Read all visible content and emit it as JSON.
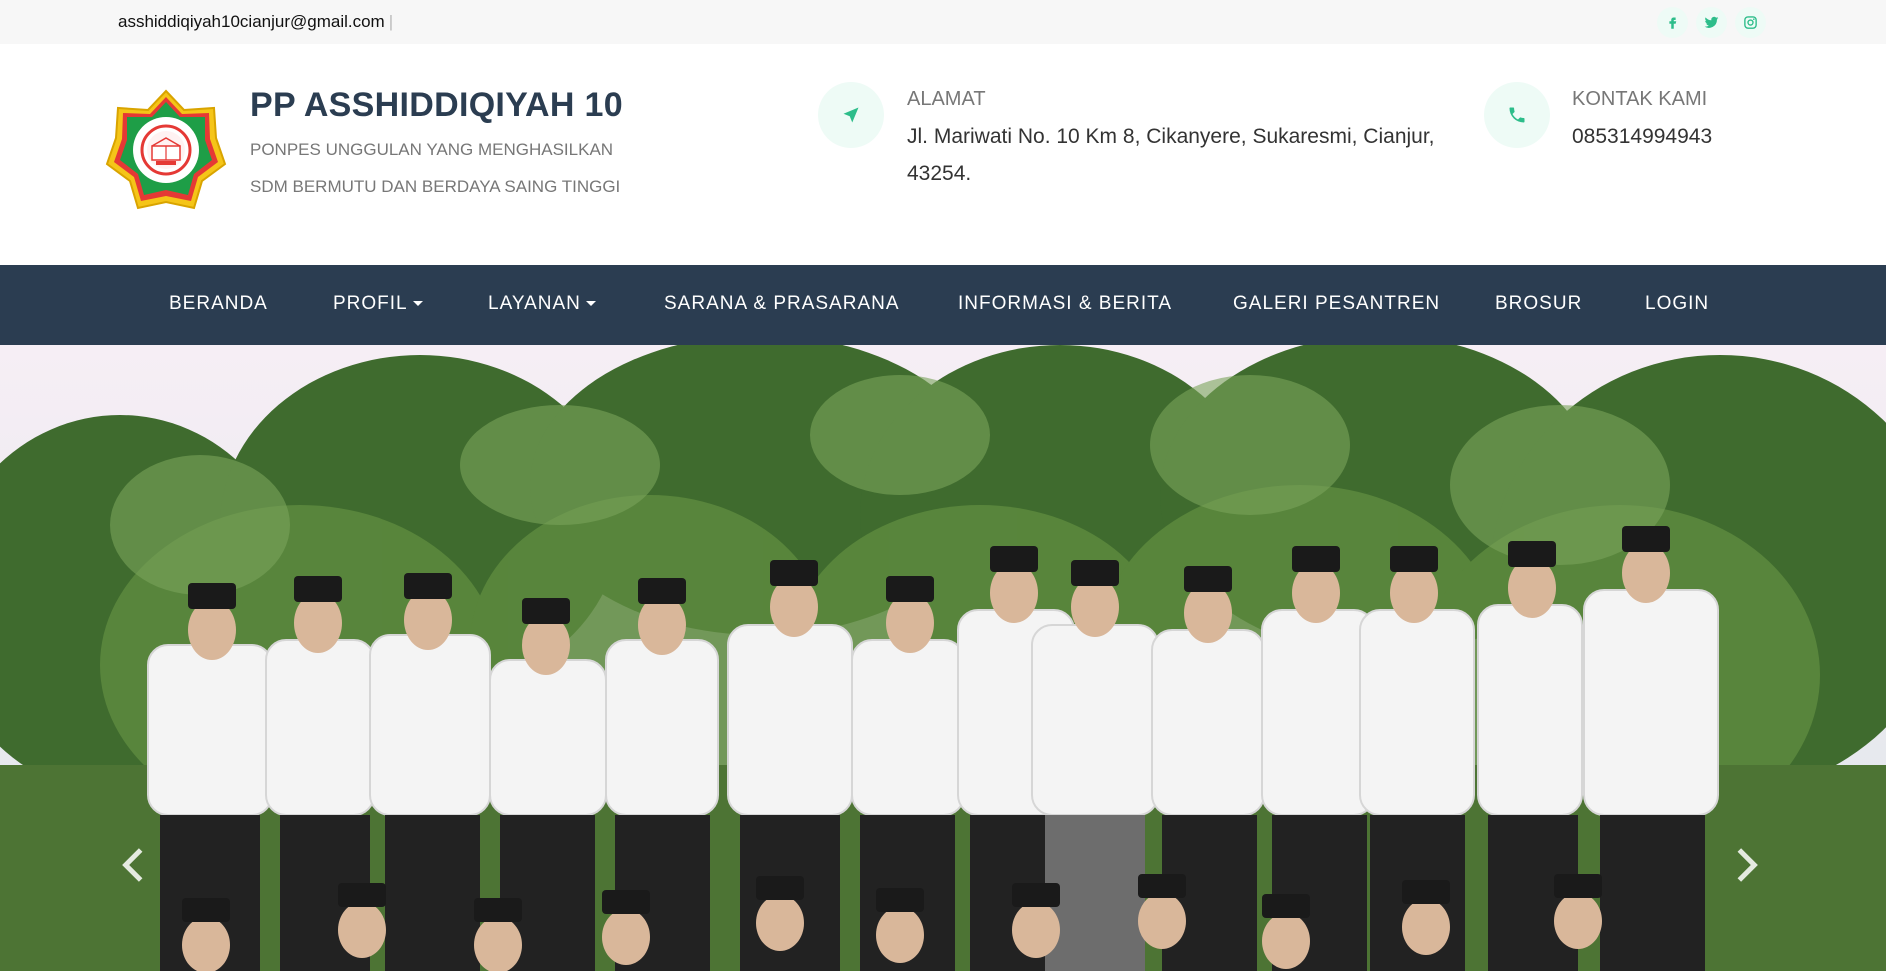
{
  "topbar": {
    "email": "asshiddiqiyah10cianjur@gmail.com",
    "separator": "|",
    "socials": [
      "facebook-icon",
      "twitter-icon",
      "instagram-icon"
    ]
  },
  "brand": {
    "title": "PP ASSHIDDIQIYAH 10",
    "subtitle_line1": "PONPES UNGGULAN YANG MENGHASILKAN",
    "subtitle_line2": "SDM BERMUTU DAN BERDAYA SAING TINGGI"
  },
  "contact": {
    "address_label": "ALAMAT",
    "address_text": "Jl. Mariwati No. 10 Km 8, Cikanyere, Sukaresmi, Cianjur, 43254.",
    "phone_label": "KONTAK KAMI",
    "phone_text": "085314994943"
  },
  "nav": {
    "items": [
      {
        "label": "BERANDA",
        "dropdown": false
      },
      {
        "label": "PROFIL",
        "dropdown": true
      },
      {
        "label": "LAYANAN",
        "dropdown": true
      },
      {
        "label": "SARANA & PRASARANA",
        "dropdown": false
      },
      {
        "label": "INFORMASI & BERITA",
        "dropdown": false
      },
      {
        "label": "GALERI PESANTREN",
        "dropdown": false
      },
      {
        "label": "BROSUR",
        "dropdown": false
      },
      {
        "label": "LOGIN",
        "dropdown": false
      }
    ]
  },
  "colors": {
    "nav_bg": "#2b3d51",
    "accent": "#2dbd8a",
    "icon_bg": "#eefbf6"
  }
}
